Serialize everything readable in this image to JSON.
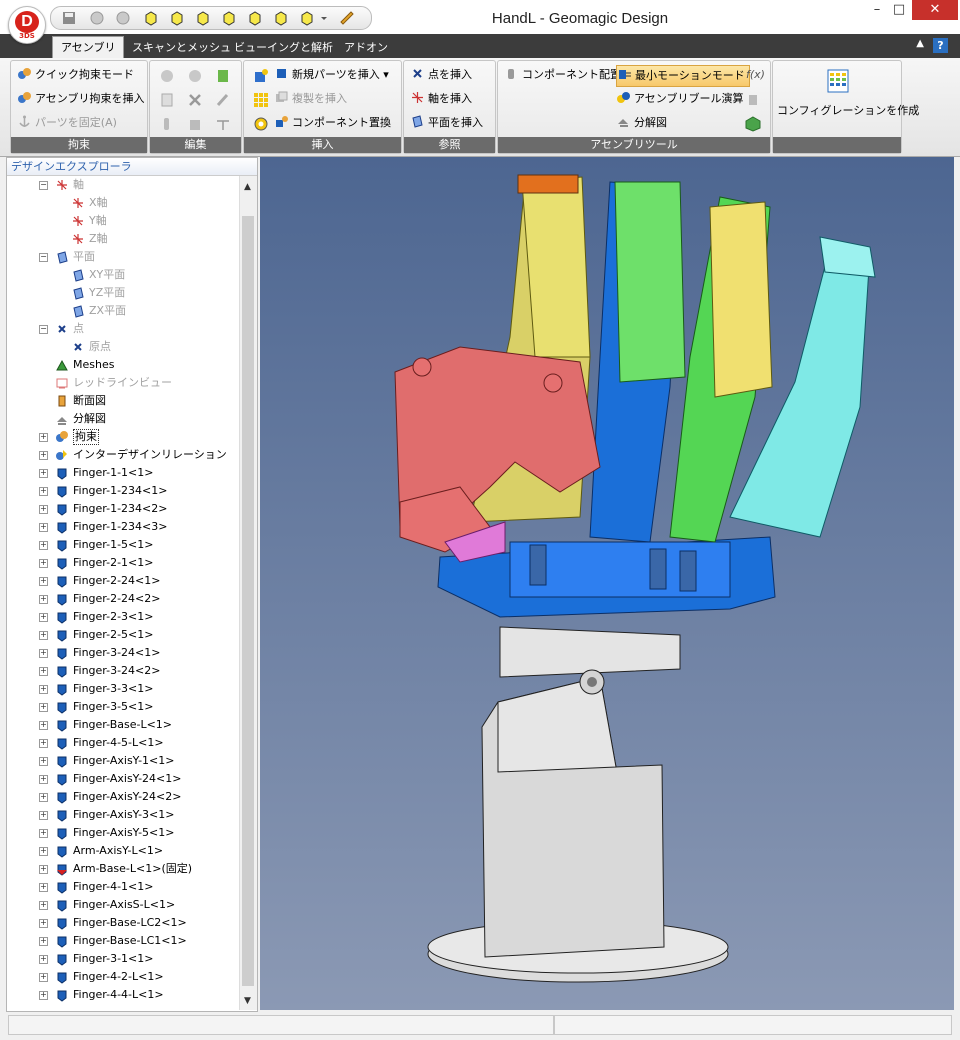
{
  "window": {
    "title": "HandL - Geomagic Design",
    "minimize": "–",
    "maximize": "□",
    "close": "✕",
    "logo_letter": "D",
    "logo_sub": "3DS"
  },
  "ribbon_tabs": [
    "アセンブリ",
    "スキャンとメッシュ",
    "ビューイングと解析",
    "アドオン"
  ],
  "ribbon": {
    "constraint": {
      "items": [
        "クイック拘束モード",
        "アセンブリ拘束を挿入",
        "パーツを固定(A)"
      ],
      "footer": "拘束"
    },
    "edit": {
      "footer": "編集"
    },
    "insert": {
      "items": [
        "新規パーツを挿入",
        "複製を挿入",
        "コンポーネント置換"
      ],
      "footer": "挿入"
    },
    "reference": {
      "items": [
        "点を挿入",
        "軸を挿入",
        "平面を挿入"
      ],
      "footer": "参照"
    },
    "assembly_tools": {
      "items": [
        "コンポーネント配置",
        "最小モーションモード",
        "アセンブリブール演算",
        "分解図"
      ],
      "fx": "f(x)",
      "footer": "アセンブリツール"
    },
    "config": {
      "label": "コンフィグレーションを作成"
    }
  },
  "explorer": {
    "title": "デザインエクスプローラ",
    "tree": [
      {
        "label": "軸",
        "depth": 0,
        "grey": true,
        "icon": "axis",
        "expander": "−"
      },
      {
        "label": "X軸",
        "depth": 1,
        "grey": true,
        "icon": "axis"
      },
      {
        "label": "Y軸",
        "depth": 1,
        "grey": true,
        "icon": "axis"
      },
      {
        "label": "Z軸",
        "depth": 1,
        "grey": true,
        "icon": "axis"
      },
      {
        "label": "平面",
        "depth": 0,
        "grey": true,
        "icon": "plane",
        "expander": "−"
      },
      {
        "label": "XY平面",
        "depth": 1,
        "grey": true,
        "icon": "plane"
      },
      {
        "label": "YZ平面",
        "depth": 1,
        "grey": true,
        "icon": "plane"
      },
      {
        "label": "ZX平面",
        "depth": 1,
        "grey": true,
        "icon": "plane"
      },
      {
        "label": "点",
        "depth": 0,
        "grey": true,
        "icon": "point",
        "expander": "−"
      },
      {
        "label": "原点",
        "depth": 1,
        "grey": true,
        "icon": "point"
      },
      {
        "label": "Meshes",
        "depth": 0,
        "grey": false,
        "icon": "mesh"
      },
      {
        "label": "レッドラインビュー",
        "depth": 0,
        "grey": true,
        "icon": "redline"
      },
      {
        "label": "断面図",
        "depth": 0,
        "grey": false,
        "icon": "section"
      },
      {
        "label": "分解図",
        "depth": 0,
        "grey": false,
        "icon": "explode"
      },
      {
        "label": "拘束",
        "depth": 0,
        "grey": false,
        "icon": "constraint",
        "expander": "+"
      },
      {
        "label": "インターデザインリレーション",
        "depth": 0,
        "grey": false,
        "icon": "relation",
        "expander": "+"
      },
      {
        "label": "Finger-1-1<1>",
        "depth": 0,
        "icon": "part",
        "expander": "+"
      },
      {
        "label": "Finger-1-234<1>",
        "depth": 0,
        "icon": "part",
        "expander": "+"
      },
      {
        "label": "Finger-1-234<2>",
        "depth": 0,
        "icon": "part",
        "expander": "+"
      },
      {
        "label": "Finger-1-234<3>",
        "depth": 0,
        "icon": "part",
        "expander": "+"
      },
      {
        "label": "Finger-1-5<1>",
        "depth": 0,
        "icon": "part",
        "expander": "+"
      },
      {
        "label": "Finger-2-1<1>",
        "depth": 0,
        "icon": "part",
        "expander": "+"
      },
      {
        "label": "Finger-2-24<1>",
        "depth": 0,
        "icon": "part",
        "expander": "+"
      },
      {
        "label": "Finger-2-24<2>",
        "depth": 0,
        "icon": "part",
        "expander": "+"
      },
      {
        "label": "Finger-2-3<1>",
        "depth": 0,
        "icon": "part",
        "expander": "+"
      },
      {
        "label": "Finger-2-5<1>",
        "depth": 0,
        "icon": "part",
        "expander": "+"
      },
      {
        "label": "Finger-3-24<1>",
        "depth": 0,
        "icon": "part",
        "expander": "+"
      },
      {
        "label": "Finger-3-24<2>",
        "depth": 0,
        "icon": "part",
        "expander": "+"
      },
      {
        "label": "Finger-3-3<1>",
        "depth": 0,
        "icon": "part",
        "expander": "+"
      },
      {
        "label": "Finger-3-5<1>",
        "depth": 0,
        "icon": "part",
        "expander": "+"
      },
      {
        "label": "Finger-Base-L<1>",
        "depth": 0,
        "icon": "part",
        "expander": "+"
      },
      {
        "label": "Finger-4-5-L<1>",
        "depth": 0,
        "icon": "part",
        "expander": "+"
      },
      {
        "label": "Finger-AxisY-1<1>",
        "depth": 0,
        "icon": "part",
        "expander": "+"
      },
      {
        "label": "Finger-AxisY-24<1>",
        "depth": 0,
        "icon": "part",
        "expander": "+"
      },
      {
        "label": "Finger-AxisY-24<2>",
        "depth": 0,
        "icon": "part",
        "expander": "+"
      },
      {
        "label": "Finger-AxisY-3<1>",
        "depth": 0,
        "icon": "part",
        "expander": "+"
      },
      {
        "label": "Finger-AxisY-5<1>",
        "depth": 0,
        "icon": "part",
        "expander": "+"
      },
      {
        "label": "Arm-AxisY-L<1>",
        "depth": 0,
        "icon": "part",
        "expander": "+"
      },
      {
        "label": "Arm-Base-L<1>(固定)",
        "depth": 0,
        "icon": "part-fixed",
        "expander": "+"
      },
      {
        "label": "Finger-4-1<1>",
        "depth": 0,
        "icon": "part",
        "expander": "+"
      },
      {
        "label": "Finger-AxisS-L<1>",
        "depth": 0,
        "icon": "part",
        "expander": "+"
      },
      {
        "label": "Finger-Base-LC2<1>",
        "depth": 0,
        "icon": "part",
        "expander": "+"
      },
      {
        "label": "Finger-Base-LC1<1>",
        "depth": 0,
        "icon": "part",
        "expander": "+"
      },
      {
        "label": "Finger-3-1<1>",
        "depth": 0,
        "icon": "part",
        "expander": "+"
      },
      {
        "label": "Finger-4-2-L<1>",
        "depth": 0,
        "icon": "part",
        "expander": "+"
      },
      {
        "label": "Finger-4-4-L<1>",
        "depth": 0,
        "icon": "part",
        "expander": "+"
      }
    ]
  },
  "colors": {
    "viewport_top": "#4d6691",
    "viewport_bottom": "#8b99b4",
    "part_icon": "#1d5fb8",
    "thumb": "#e57070",
    "index": "#e8e070",
    "middle": "#6ee06a",
    "ring": "#f0e070",
    "little": "#7fe9e6",
    "palm": "#1b6fd8",
    "base": "#e0e0e0"
  }
}
